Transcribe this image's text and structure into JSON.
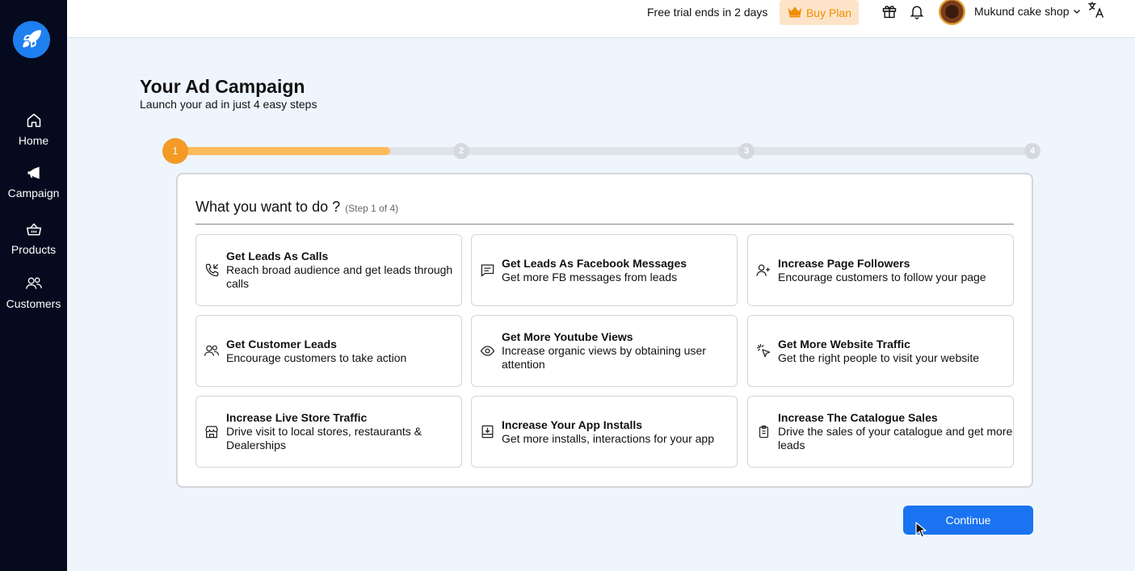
{
  "sidebar": {
    "items": [
      {
        "label": "Home",
        "icon": "home-icon"
      },
      {
        "label": "Campaign",
        "icon": "megaphone-icon"
      },
      {
        "label": "Products",
        "icon": "basket-icon"
      },
      {
        "label": "Customers",
        "icon": "users-icon"
      }
    ]
  },
  "topbar": {
    "trial_text": "Free trial ends in 2 days",
    "buy_plan_label": "Buy Plan",
    "shop_name": "Mukund cake shop"
  },
  "header": {
    "title": "Your Ad Campaign",
    "subtitle": "Launch your ad in just 4 easy steps"
  },
  "stepper": {
    "steps": [
      "1",
      "2",
      "3",
      "4"
    ],
    "current_step": 1,
    "progress_fraction": 0.25
  },
  "card": {
    "heading": "What you want to do ?",
    "step_note": "(Step 1 of 4)",
    "options": [
      {
        "title": "Get Leads As Calls",
        "desc": "Reach broad audience and get leads through calls",
        "icon": "phone-call-icon"
      },
      {
        "title": "Get Leads As Facebook Messages",
        "desc": "Get more FB messages from leads",
        "icon": "message-icon"
      },
      {
        "title": "Increase Page Followers",
        "desc": "Encourage customers to follow your page",
        "icon": "user-plus-icon"
      },
      {
        "title": "Get Customer Leads",
        "desc": "Encourage customers to take action",
        "icon": "users-icon"
      },
      {
        "title": "Get More Youtube Views",
        "desc": "Increase organic views by obtaining user attention",
        "icon": "eye-icon"
      },
      {
        "title": "Get More Website Traffic",
        "desc": "Get the right people to visit your website",
        "icon": "click-icon"
      },
      {
        "title": "Increase Live Store Traffic",
        "desc": "Drive visit to local stores, restaurants & Dealerships",
        "icon": "store-icon"
      },
      {
        "title": "Increase Your App Installs",
        "desc": "Get more installs, interactions for your app",
        "icon": "app-install-icon"
      },
      {
        "title": "Increase The Catalogue Sales",
        "desc": "Drive the sales of your catalogue and get more leads",
        "icon": "clipboard-icon"
      }
    ]
  },
  "actions": {
    "continue_label": "Continue"
  },
  "colors": {
    "sidebar_bg": "#050a1e",
    "accent_blue": "#1a73f0",
    "step_orange": "#f39a27",
    "progress_orange": "#fdbb5d",
    "page_bg": "#eef5fd"
  }
}
